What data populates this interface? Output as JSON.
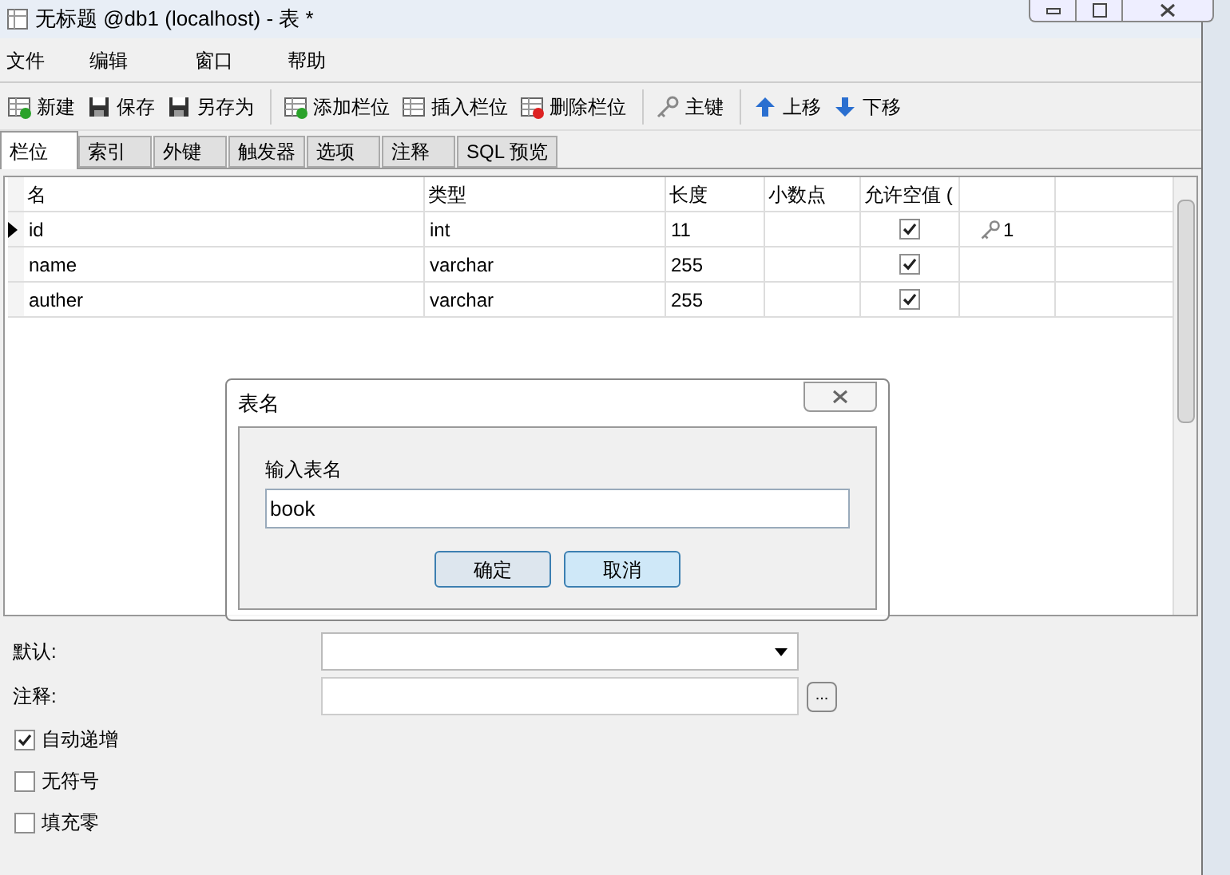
{
  "window": {
    "title": "无标题 @db1 (localhost) - 表 *"
  },
  "menu": [
    "文件",
    "编辑",
    "窗口",
    "帮助"
  ],
  "toolbar": [
    [
      {
        "label": "新建",
        "kind": "new"
      },
      {
        "label": "保存",
        "kind": "save"
      },
      {
        "label": "另存为",
        "kind": "saveas"
      }
    ],
    [
      {
        "label": "添加栏位",
        "kind": "add"
      },
      {
        "label": "插入栏位",
        "kind": "insert"
      },
      {
        "label": "删除栏位",
        "kind": "delete"
      }
    ],
    [
      {
        "label": "主键",
        "kind": "key"
      }
    ],
    [
      {
        "label": "上移",
        "kind": "up"
      },
      {
        "label": "下移",
        "kind": "down"
      }
    ]
  ],
  "tabs": [
    {
      "label": "栏位",
      "selected": true
    },
    {
      "label": "索引",
      "selected": false
    },
    {
      "label": "外键",
      "selected": false
    },
    {
      "label": "触发器",
      "selected": false
    },
    {
      "label": "选项",
      "selected": false
    },
    {
      "label": "注释",
      "selected": false
    },
    {
      "label": "SQL 预览",
      "selected": false
    }
  ],
  "table": {
    "columns": [
      "名",
      "类型",
      "长度",
      "小数点",
      "允许空值 ("
    ],
    "rows": [
      {
        "name": "id",
        "type": "int",
        "length": "11",
        "not_null": true,
        "key": "1",
        "selected": true
      },
      {
        "name": "name",
        "type": "varchar",
        "length": "255",
        "not_null": true,
        "selected": false
      },
      {
        "name": "auther",
        "type": "varchar",
        "length": "255",
        "not_null": true,
        "selected": false
      }
    ]
  },
  "dialog": {
    "title": "表名",
    "label": "输入表名",
    "value": "book",
    "ok": "确定",
    "cancel": "取消"
  },
  "form": {
    "default_label": "默认:",
    "comment_label": "注释:",
    "more": "...",
    "options": [
      {
        "label": "自动递增",
        "checked": true
      },
      {
        "label": "无符号",
        "checked": false
      },
      {
        "label": "填充零",
        "checked": false
      }
    ]
  }
}
